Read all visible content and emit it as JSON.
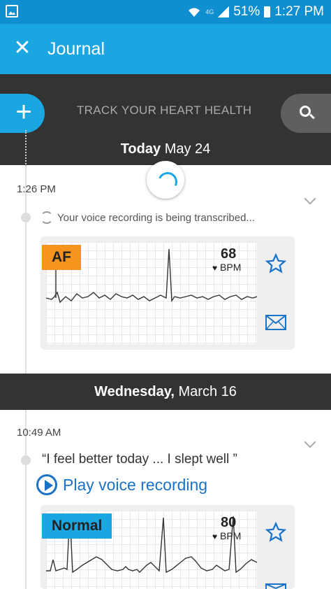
{
  "status_bar": {
    "battery": "51%",
    "time": "1:27 PM",
    "network": "4G"
  },
  "app_bar": {
    "title": "Journal",
    "close_icon": "close-icon"
  },
  "toolbar": {
    "track_text": "TRACK YOUR HEART HEALTH",
    "add_icon": "plus-icon",
    "search_icon": "search-icon"
  },
  "colors": {
    "primary": "#1aa6e1",
    "dark": "#333333",
    "af_badge": "#f7941d",
    "normal_badge": "#1aa6e1",
    "link": "#1a73c8"
  },
  "sections": [
    {
      "day_bold": "Today",
      "day_rest": "May 24",
      "entries": [
        {
          "time": "1:26 PM",
          "status_text": "Your voice recording is being transcribed...",
          "ecg": {
            "badge": "AF",
            "bpm": "68",
            "unit": "BPM"
          }
        }
      ]
    },
    {
      "day_bold": "Wednesday,",
      "day_rest": "March 16",
      "entries": [
        {
          "time": "10:49 AM",
          "note": "“I feel better today ... I slept well ”",
          "play_label": "Play voice recording",
          "ecg": {
            "badge": "Normal",
            "bpm": "80",
            "unit": "BPM"
          }
        }
      ]
    }
  ]
}
